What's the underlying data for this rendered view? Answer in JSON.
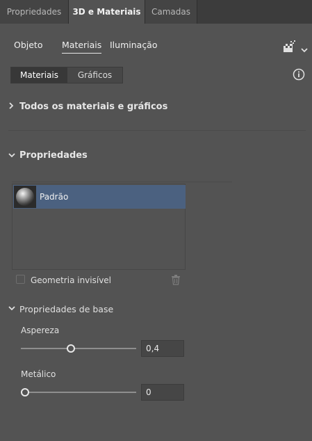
{
  "tabs": [
    {
      "label": "Propriedades",
      "active": false
    },
    {
      "label": "3D e Materiais",
      "active": true
    },
    {
      "label": "Camadas",
      "active": false
    }
  ],
  "subtabs": [
    {
      "label": "Objeto",
      "active": false
    },
    {
      "label": "Materiais",
      "active": true
    },
    {
      "label": "Iluminação",
      "active": false
    }
  ],
  "toolbar": {
    "render_icon": "render-settings-icon",
    "dropdown_icon": "chevron-down-icon",
    "info_icon": "info-icon"
  },
  "segmented": {
    "materials_label": "Materiais",
    "graphics_label": "Gráficos",
    "selected": "Materiais"
  },
  "sections": {
    "all_materials": {
      "label": "Todos os materiais e gráficos",
      "expanded": false
    },
    "properties": {
      "label": "Propriedades",
      "expanded": true
    },
    "base_properties": {
      "label": "Propriedades de base",
      "expanded": true
    }
  },
  "material_list": {
    "items": [
      {
        "label": "Padrão",
        "selected": true,
        "thumbnail": "sphere"
      }
    ]
  },
  "invisible_geometry": {
    "label": "Geometria invisível",
    "checked": false,
    "enabled": false
  },
  "delete_icon": "trash-icon",
  "roughness": {
    "label": "Aspereza",
    "value": "0,4",
    "fraction": 0.4
  },
  "metallic": {
    "label": "Metálico",
    "value": "0",
    "fraction": 0.0
  },
  "colors": {
    "panel": "#535353",
    "tabbar": "#3c3c3c",
    "selection": "#4b6180",
    "accent_text": "#f2f2f2"
  }
}
